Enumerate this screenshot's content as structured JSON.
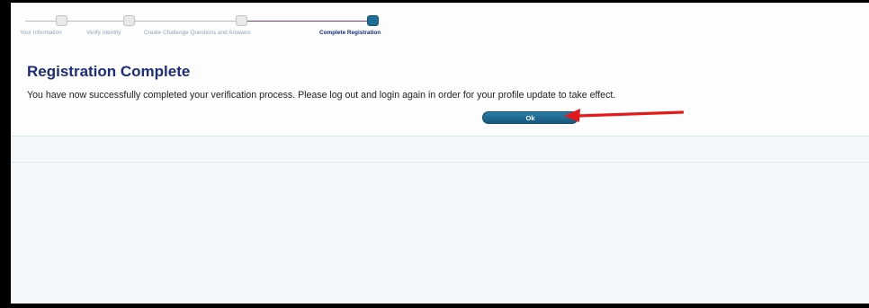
{
  "stepper": {
    "steps": [
      {
        "label": "Your Information"
      },
      {
        "label": "Verify Identity"
      },
      {
        "label": "Create Challenge Questions and Answers"
      },
      {
        "label": "Complete Registration"
      }
    ]
  },
  "page": {
    "heading": "Registration Complete",
    "message": "You have now successfully completed your verification process. Please log out and login again in order for your profile update to take effect."
  },
  "actions": {
    "ok_label": "Ok"
  },
  "colors": {
    "heading": "#1b2c7c",
    "button": "#1d6f9a",
    "arrow": "#e41a1a",
    "active_line": "#7b3d7a"
  }
}
